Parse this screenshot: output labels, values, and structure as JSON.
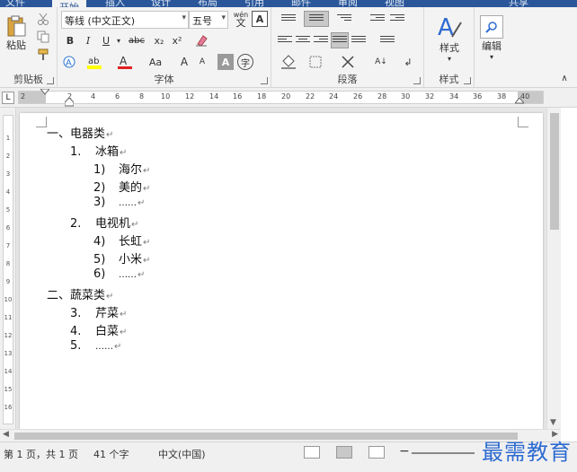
{
  "tabs": {
    "file": "文件",
    "home": "开始",
    "others": [
      "插入",
      "设计",
      "布局",
      "引用",
      "邮件",
      "审阅",
      "视图"
    ],
    "share": "共享"
  },
  "ribbon": {
    "clipboard": {
      "paste": "粘贴",
      "label": "剪贴板"
    },
    "font": {
      "font_name": "等线 (中文正文)",
      "font_size": "五号",
      "phonetic": "wén",
      "bold": "B",
      "italic": "I",
      "underline": "U",
      "strike": "abc",
      "subscript": "x₂",
      "superscript": "x²",
      "change_case": "Aa",
      "grow": "A",
      "shrink": "A",
      "char_border": "A",
      "enclose": "字",
      "label": "字体"
    },
    "paragraph": {
      "label": "段落"
    },
    "styles": {
      "button": "样式",
      "label": "样式"
    },
    "editing": {
      "button": "编辑"
    }
  },
  "ruler": {
    "ticks": [
      "2",
      "2",
      "4",
      "6",
      "8",
      "10",
      "12",
      "14",
      "16",
      "18",
      "20",
      "22",
      "24",
      "26",
      "28",
      "30",
      "32",
      "34",
      "36",
      "38",
      "40"
    ]
  },
  "document": {
    "lines": [
      {
        "num": "一、",
        "text": "电器类"
      },
      {
        "num": "1.",
        "text": "冰箱"
      },
      {
        "num": "1)",
        "text": "海尔"
      },
      {
        "num": "2)",
        "text": "美的"
      },
      {
        "num": "3)",
        "text": "……"
      },
      {
        "num": "2.",
        "text": "电视机"
      },
      {
        "num": "4)",
        "text": "长虹"
      },
      {
        "num": "5)",
        "text": "小米"
      },
      {
        "num": "6)",
        "text": "……"
      },
      {
        "num": "二、",
        "text": "蔬菜类"
      },
      {
        "num": "3.",
        "text": "芹菜"
      },
      {
        "num": "4.",
        "text": "白菜"
      },
      {
        "num": "5.",
        "text": "……"
      }
    ]
  },
  "status": {
    "page": "第 1 页，共 1 页",
    "words": "41 个字",
    "language": "中文(中国)"
  },
  "watermark": "最需教育",
  "colors": {
    "accent": "#2b579a",
    "watermark": "#2e6bd1"
  }
}
